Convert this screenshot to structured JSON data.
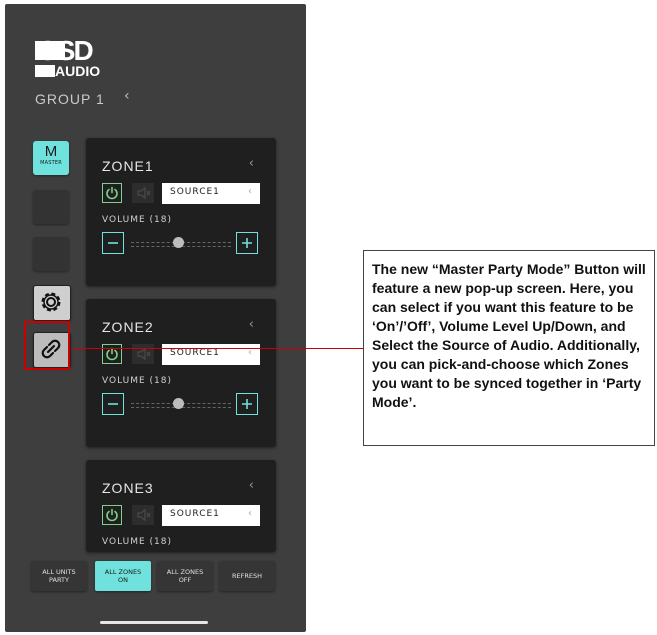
{
  "app": {
    "logo_top": "OSD",
    "logo_bottom": "AUDIO",
    "group_label": "GROUP 1",
    "group_chevron": "‹"
  },
  "sidebar": {
    "master_letter": "M",
    "master_label": "MASTER",
    "buttons": [
      "master-button",
      "blank-button-1",
      "blank-button-2",
      "settings-button",
      "party-link-button"
    ]
  },
  "zones": [
    {
      "name": "ZONE1",
      "source": "SOURCE1",
      "volume_label": "VOLUME (18)",
      "volume": 18
    },
    {
      "name": "ZONE2",
      "source": "SOURCE1",
      "volume_label": "VOLUME (18)",
      "volume": 18
    },
    {
      "name": "ZONE3",
      "source": "SOURCE1",
      "volume_label": "VOLUME (18)",
      "volume": 18
    }
  ],
  "chevron": "‹",
  "bottom_bar": {
    "all_units_party": [
      "ALL UNITS",
      "PARTY"
    ],
    "all_zones_on": [
      "ALL ZONES",
      "ON"
    ],
    "all_zones_off": [
      "ALL ZONES",
      "OFF"
    ],
    "refresh": "REFRESH"
  },
  "callout": {
    "text": "The new “Master Party Mode” Button will feature a new pop-up screen. Here, you can select if you want this feature to be ‘On’/’Off’, Volume Level Up/Down, and Select the Source of Audio. Additionally, you can pick-and-choose which Zones you want to be synced together in ‘Party Mode’."
  },
  "colors": {
    "accent": "#6fe2dd",
    "power_green": "#7fd08a",
    "highlight_red": "#cc0000",
    "panel_bg": "#3e3e3e",
    "zone_bg": "#1f1f1f"
  }
}
